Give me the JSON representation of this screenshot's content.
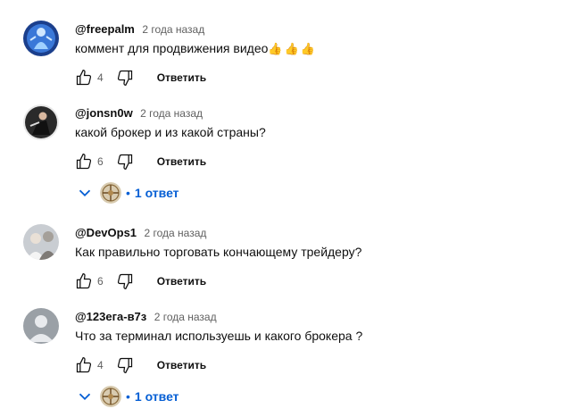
{
  "comments": [
    {
      "author": "@freepalm",
      "time": "2 года назад",
      "text": "коммент для продвижения видео",
      "emoji": "👍👍👍",
      "likes": "4",
      "reply_label": "Ответить",
      "avatar_icon": "blue-figure-avatar"
    },
    {
      "author": "@jonsn0w",
      "time": "2 года назад",
      "text": "какой брокер и из какой страны?",
      "likes": "6",
      "reply_label": "Ответить",
      "avatar_icon": "dark-figure-avatar",
      "replies_label": "1 ответ"
    },
    {
      "author": "@DevOps1",
      "time": "2 года назад",
      "text": "Как правильно торговать кончающему трейдеру?",
      "likes": "6",
      "reply_label": "Ответить",
      "avatar_icon": "photo-people-avatar"
    },
    {
      "author": "@123ега-в7з",
      "time": "2 года назад",
      "text": "Что за терминал используешь и какого брокера ?",
      "likes": "4",
      "reply_label": "Ответить",
      "avatar_icon": "default-person-avatar",
      "replies_label": "1 ответ"
    }
  ],
  "colors": {
    "link_blue": "#065fd4",
    "meta_gray": "#606060",
    "text_dark": "#0f0f0f"
  }
}
